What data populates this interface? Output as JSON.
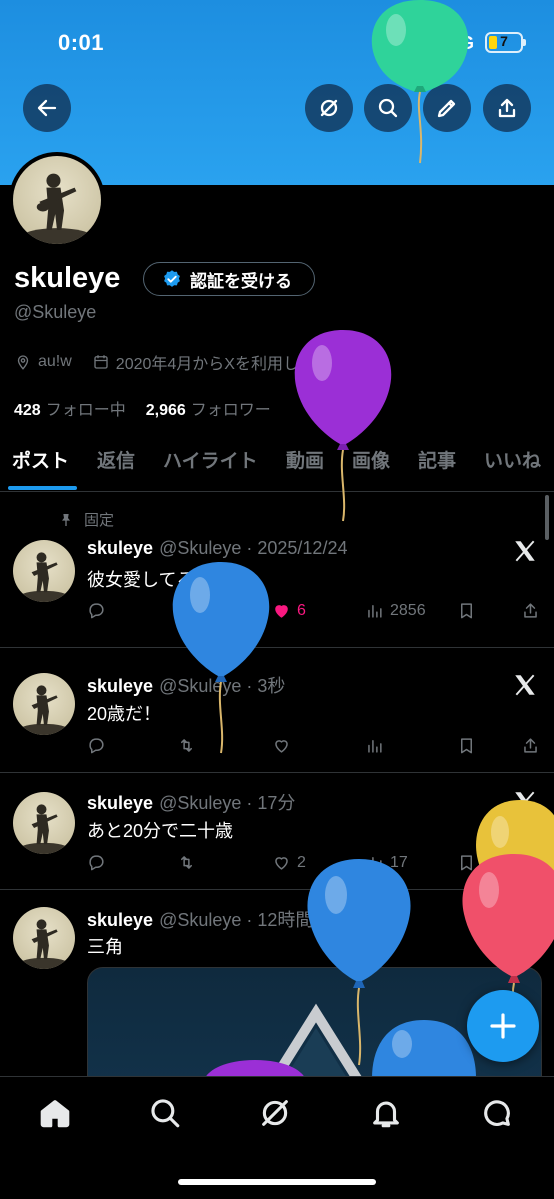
{
  "status_bar": {
    "time": "0:01",
    "network": "5G",
    "battery": "7"
  },
  "header": {
    "back_icon": "arrow-left-icon",
    "actions": [
      "grok-icon",
      "search-icon",
      "edit-icon",
      "share-icon"
    ]
  },
  "profile": {
    "name": "skuleye",
    "verify_button": "認証を受ける",
    "handle": "@Skuleye",
    "location": "au!w",
    "joined": "2020年4月からXを利用しています",
    "following_count": "428",
    "following_label": "フォロー中",
    "followers_count": "2,966",
    "followers_label": "フォロワー"
  },
  "tabs": [
    "ポスト",
    "返信",
    "ハイライト",
    "動画",
    "画像",
    "記事",
    "いいね"
  ],
  "pinned_label": "固定",
  "tweets": [
    {
      "name": "skuleye",
      "handle": "@Skuleye",
      "time": "2025/12/24",
      "text": "彼女愛してる",
      "replies": "",
      "reposts": "",
      "likes": "6",
      "views": "2856",
      "liked": true
    },
    {
      "name": "skuleye",
      "handle": "@Skuleye",
      "time": "3秒",
      "text": "20歳だ！",
      "replies": "",
      "reposts": "",
      "likes": "",
      "views": "",
      "liked": false
    },
    {
      "name": "skuleye",
      "handle": "@Skuleye",
      "time": "17分",
      "text": "あと20分で二十歳",
      "replies": "",
      "reposts": "",
      "likes": "2",
      "views": "17",
      "liked": false
    },
    {
      "name": "skuleye",
      "handle": "@Skuleye",
      "time": "12時間",
      "text": "三角",
      "has_media": true
    }
  ],
  "fab_icon": "plus-icon",
  "bottom_nav": [
    "home-icon",
    "search-icon",
    "grok-icon",
    "bell-icon",
    "message-icon"
  ],
  "colors": {
    "accent": "#1d9bf0",
    "banner": "#2aa2ef",
    "like": "#f91880",
    "balloons": [
      "#2fd39a",
      "#9b2fd6",
      "#2f86e0",
      "#2f86e0",
      "#e8c23a",
      "#f0506a",
      "#2f86e0",
      "#9b2fd6"
    ]
  }
}
